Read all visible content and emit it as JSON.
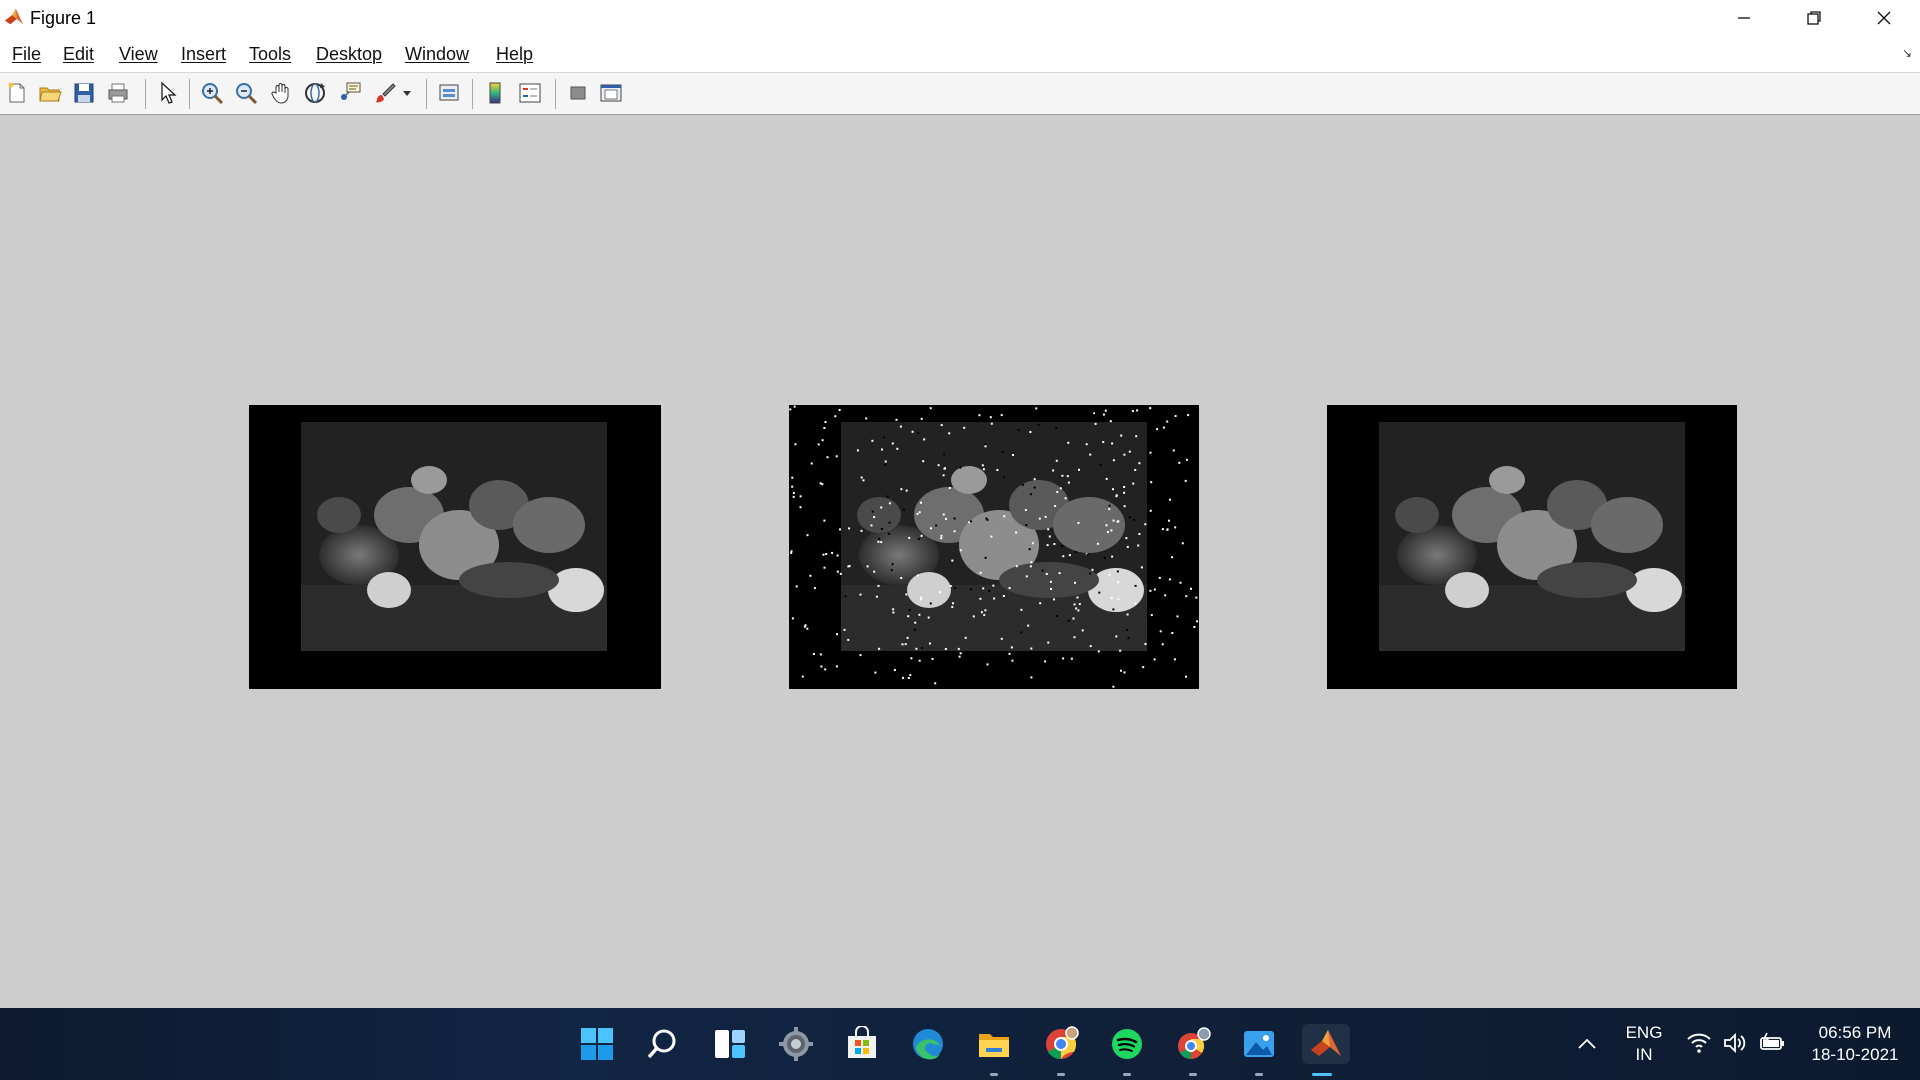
{
  "window": {
    "title": "Figure 1",
    "controls": {
      "minimize": "minimize-icon",
      "restore": "restore-icon",
      "close": "close-icon"
    }
  },
  "menu": {
    "items": [
      {
        "label": "File"
      },
      {
        "label": "Edit"
      },
      {
        "label": "View"
      },
      {
        "label": "Insert"
      },
      {
        "label": "Tools"
      },
      {
        "label": "Desktop"
      },
      {
        "label": "Window"
      },
      {
        "label": "Help"
      }
    ]
  },
  "toolbar": {
    "icons": [
      "new-figure-icon",
      "open-file-icon",
      "save-icon",
      "print-icon",
      "edit-plot-arrow-icon",
      "zoom-in-icon",
      "zoom-out-icon",
      "pan-hand-icon",
      "rotate-3d-icon",
      "data-cursor-icon",
      "brush-icon",
      "link-plot-icon",
      "insert-colorbar-icon",
      "insert-legend-icon",
      "hide-plot-tools-icon",
      "show-plot-tools-icon"
    ]
  },
  "figure": {
    "panels": [
      {
        "name": "original-image",
        "noise": "none"
      },
      {
        "name": "noisy-image",
        "noise": "salt-and-pepper"
      },
      {
        "name": "filtered-image",
        "noise": "none"
      }
    ]
  },
  "taskbar": {
    "apps": [
      "windows-start-icon",
      "search-icon",
      "task-view-icon",
      "settings-icon",
      "microsoft-store-icon",
      "edge-icon",
      "file-explorer-icon",
      "chrome-icon",
      "spotify-icon",
      "chrome-profile-icon",
      "photos-icon",
      "matlab-icon"
    ],
    "active_app": "matlab-icon",
    "tray": {
      "lang_line1": "ENG",
      "lang_line2": "IN",
      "time": "06:56 PM",
      "date": "18-10-2021"
    }
  },
  "colors": {
    "figure_background": "#cdcdcd",
    "axes_background": "#000000",
    "taskbar_accent": "#4cc2ff"
  }
}
